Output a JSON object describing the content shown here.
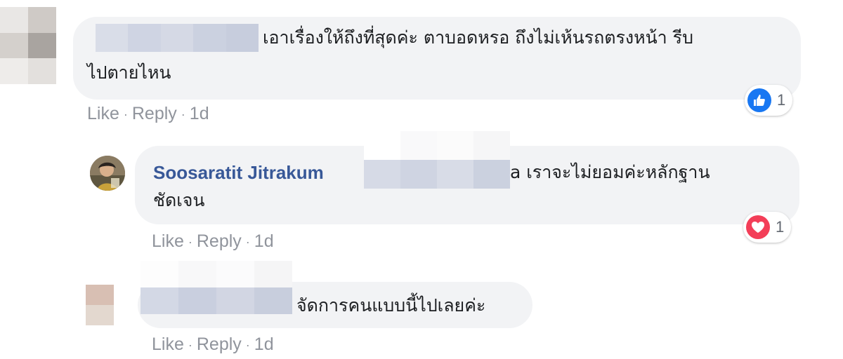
{
  "comments": [
    {
      "text_line1": "เอาเรื่องให้ถึงที่สุดค่ะ ตาบอดหรอ ถึงไม่เห้นรถตรงหน้า รีบ",
      "text_line2": "ไปตายไหน",
      "actions": {
        "like": "Like",
        "reply": "Reply",
        "separator": "·",
        "time": "1d"
      },
      "reaction": {
        "icon": "like-icon",
        "color": "#1877f2",
        "count": "1"
      }
    },
    {
      "author": "Soosaratit Jitrakum",
      "text_tail": "a เราจะไม่ยอมค่ะหลักฐาน",
      "text_line2": "ชัดเจน",
      "actions": {
        "like": "Like",
        "reply": "Reply",
        "separator": "·",
        "time": "1d"
      },
      "reaction": {
        "icon": "heart-icon",
        "color": "#f33e58",
        "count": "1"
      }
    },
    {
      "text_line1": "จัดการคนแบบนี้ไปเลยค่ะ",
      "actions": {
        "like": "Like",
        "reply": "Reply",
        "separator": "·",
        "time": "1d"
      }
    }
  ]
}
